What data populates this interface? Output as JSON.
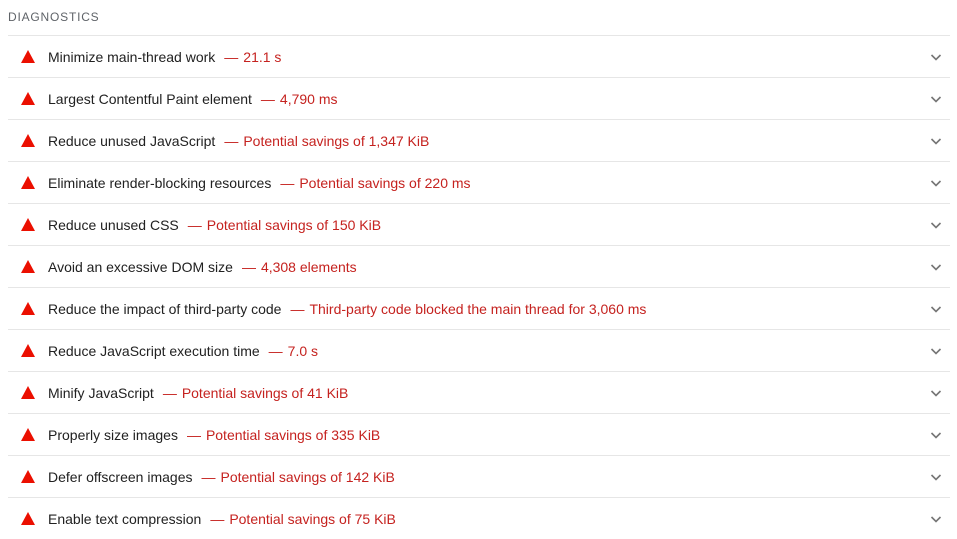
{
  "section": {
    "title": "DIAGNOSTICS"
  },
  "colors": {
    "fail": "#eb0f00",
    "value_text": "#c5221f",
    "divider": "#e6e6e6"
  },
  "separator": "—",
  "audits": [
    {
      "title": "Minimize main-thread work",
      "value": "21.1 s",
      "icon": "warning-triangle-icon"
    },
    {
      "title": "Largest Contentful Paint element",
      "value": "4,790 ms",
      "icon": "warning-triangle-icon"
    },
    {
      "title": "Reduce unused JavaScript",
      "value": "Potential savings of 1,347 KiB",
      "icon": "warning-triangle-icon"
    },
    {
      "title": "Eliminate render-blocking resources",
      "value": "Potential savings of 220 ms",
      "icon": "warning-triangle-icon"
    },
    {
      "title": "Reduce unused CSS",
      "value": "Potential savings of 150 KiB",
      "icon": "warning-triangle-icon"
    },
    {
      "title": "Avoid an excessive DOM size",
      "value": "4,308 elements",
      "icon": "warning-triangle-icon"
    },
    {
      "title": "Reduce the impact of third-party code",
      "value": "Third-party code blocked the main thread for 3,060 ms",
      "icon": "warning-triangle-icon"
    },
    {
      "title": "Reduce JavaScript execution time",
      "value": "7.0 s",
      "icon": "warning-triangle-icon"
    },
    {
      "title": "Minify JavaScript",
      "value": "Potential savings of 41 KiB",
      "icon": "warning-triangle-icon"
    },
    {
      "title": "Properly size images",
      "value": "Potential savings of 335 KiB",
      "icon": "warning-triangle-icon"
    },
    {
      "title": "Defer offscreen images",
      "value": "Potential savings of 142 KiB",
      "icon": "warning-triangle-icon"
    },
    {
      "title": "Enable text compression",
      "value": "Potential savings of 75 KiB",
      "icon": "warning-triangle-icon"
    }
  ]
}
